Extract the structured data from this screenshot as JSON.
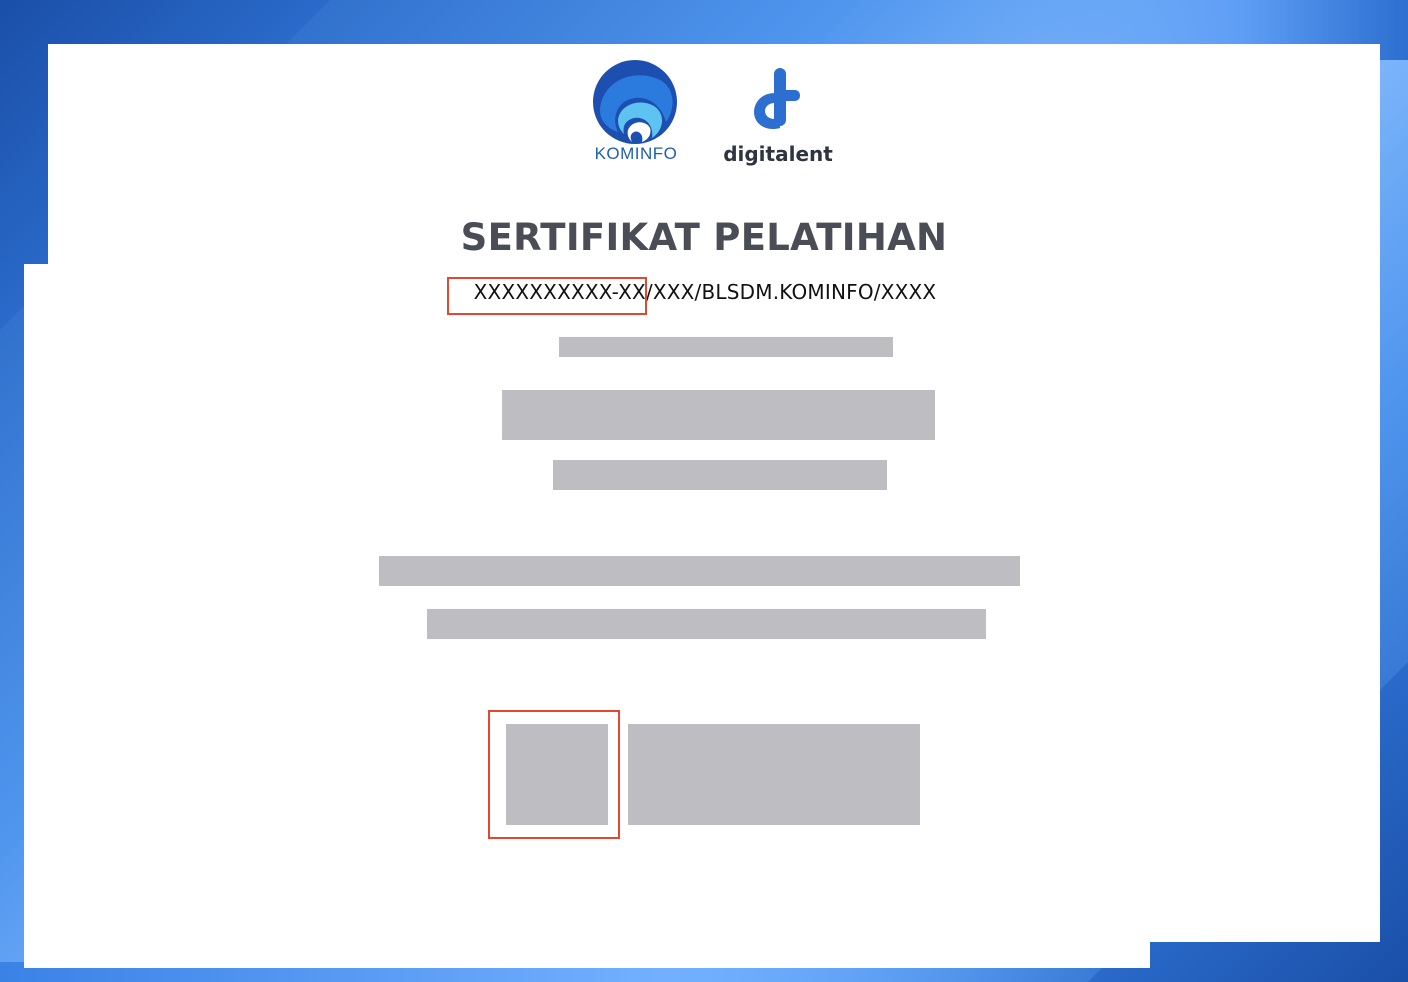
{
  "certificate": {
    "logos": {
      "kominfo_label": "KOMINFO",
      "digitalent_label": "digitalent"
    },
    "title": "SERTIFIKAT PELATIHAN",
    "number": "XXXXXXXXXX-XX/XXX/BLSDM.KOMINFO/XXXX"
  },
  "colors": {
    "background_blue": "#2d6fd0",
    "paper": "#ffffff",
    "title_text": "#4a4d55",
    "highlight_border": "#e2472f",
    "redaction": "#bdbdc2",
    "kominfo_blue": "#1f5fb2"
  }
}
